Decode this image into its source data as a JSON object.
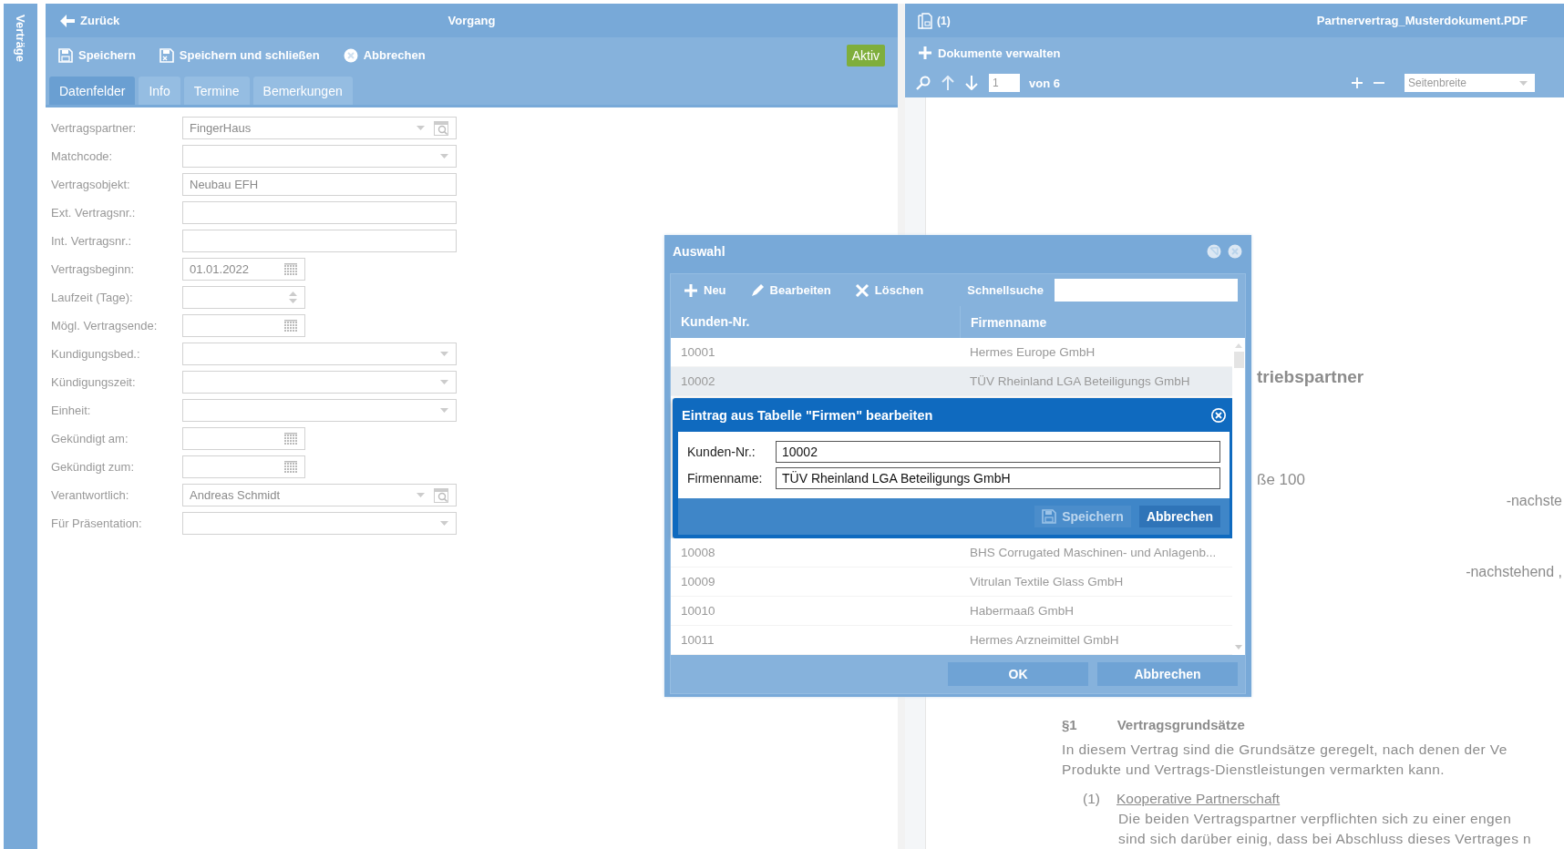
{
  "sidebar": {
    "label": "Verträge"
  },
  "main": {
    "back": "Zurück",
    "title": "Vorgang",
    "toolbar": [
      {
        "label": "Speichern",
        "kind": "save"
      },
      {
        "label": "Speichern und schließen",
        "kind": "saveclose"
      },
      {
        "label": "Abbrechen",
        "kind": "cancel"
      }
    ],
    "status_badge": "Aktiv",
    "tabs": [
      {
        "label": "Datenfelder",
        "selected": true
      },
      {
        "label": "Info",
        "selected": false
      },
      {
        "label": "Termine",
        "selected": false
      },
      {
        "label": "Bemerkungen",
        "selected": false
      }
    ],
    "fields": [
      {
        "label": "Vertragspartner:",
        "kind": "lookup",
        "value": "FingerHaus"
      },
      {
        "label": "Matchcode:",
        "kind": "select"
      },
      {
        "label": "Vertragsobjekt:",
        "kind": "text",
        "value": "Neubau EFH"
      },
      {
        "label": "Ext. Vertragsnr.:",
        "kind": "text"
      },
      {
        "label": "Int. Vertragsnr.:",
        "kind": "text"
      },
      {
        "label": "Vertragsbeginn:",
        "kind": "date",
        "value": "01.01.2022"
      },
      {
        "label": "Laufzeit (Tage):",
        "kind": "spinner"
      },
      {
        "label": "Mögl. Vertragsende:",
        "kind": "date"
      },
      {
        "label": "Kundigungsbed.:",
        "kind": "select"
      },
      {
        "label": "Kündigungszeit:",
        "kind": "select"
      },
      {
        "label": "Einheit:",
        "kind": "select"
      },
      {
        "label": "Gekündigt am:",
        "kind": "date"
      },
      {
        "label": "Gekündigt zum:",
        "kind": "date"
      },
      {
        "label": "Verantwortlich:",
        "kind": "lookup",
        "value": "Andreas Schmidt"
      },
      {
        "label": "Für Präsentation:",
        "kind": "select"
      }
    ]
  },
  "viewer": {
    "count": "(1)",
    "filename": "Partnervertrag_Musterdokument.PDF",
    "manage": "Dokumente verwalten",
    "page": "1",
    "page_total": "von 6",
    "zoom": "Seitenbreite",
    "document": [
      {
        "kind": "title",
        "text": "triebspartner"
      },
      {
        "kind": "address",
        "text": "ße 100"
      },
      {
        "kind": "right",
        "text": "-nachste"
      },
      {
        "kind": "right2",
        "text": "-nachstehend ,"
      },
      {
        "kind": "section",
        "number": "§1",
        "text": "Vertragsgrundsätze"
      },
      {
        "kind": "para",
        "text": "In diesem Vertrag sind die Grundsätze geregelt, nach denen der Ve"
      },
      {
        "kind": "para2",
        "text": "Produkte und Vertrags-Dienstleistungen vermarkten kann."
      },
      {
        "kind": "item",
        "number": "(1)",
        "text": "Kooperative Partnerschaft"
      },
      {
        "kind": "itemtext",
        "text": "Die beiden Vertragspartner verpflichten sich zu einer engen"
      },
      {
        "kind": "itemtext",
        "text": "sind sich darüber einig, dass bei Abschluss dieses Vertrages n"
      }
    ]
  },
  "selection_dialog": {
    "title": "Auswahl",
    "toolbar": [
      {
        "label": "Neu",
        "kind": "add"
      },
      {
        "label": "Bearbeiten",
        "kind": "edit"
      },
      {
        "label": "Löschen",
        "kind": "delete"
      }
    ],
    "search_label": "Schnellsuche",
    "columns": [
      "Kunden-Nr.",
      "Firmenname"
    ],
    "rows": [
      {
        "number": "10001",
        "name": "Hermes Europe GmbH",
        "selected": false
      },
      {
        "number": "10002",
        "name": "TÜV Rheinland LGA Beteiligungs GmbH",
        "selected": true
      },
      {
        "number": "10008",
        "name": "BHS Corrugated Maschinen- und Anlagenb...",
        "selected": false
      },
      {
        "number": "10009",
        "name": "Vitrulan Textile Glass GmbH",
        "selected": false
      },
      {
        "number": "10010",
        "name": "Habermaaß GmbH",
        "selected": false
      },
      {
        "number": "10011",
        "name": "Hermes Arzneimittel GmbH",
        "selected": false
      }
    ],
    "buttons": [
      {
        "label": "OK"
      },
      {
        "label": "Abbrechen"
      }
    ]
  },
  "edit_dialog": {
    "title": "Eintrag aus Tabelle \"Firmen\" bearbeiten",
    "fields": [
      {
        "label": "Kunden-Nr.:",
        "value": "10002"
      },
      {
        "label": "Firmenname:",
        "value": "TÜV Rheinland LGA Beteiligungs GmbH"
      }
    ],
    "buttons": [
      {
        "label": "Speichern",
        "kind": "save",
        "disabled": true
      },
      {
        "label": "Abbrechen",
        "kind": "cancel",
        "disabled": false
      }
    ]
  }
}
